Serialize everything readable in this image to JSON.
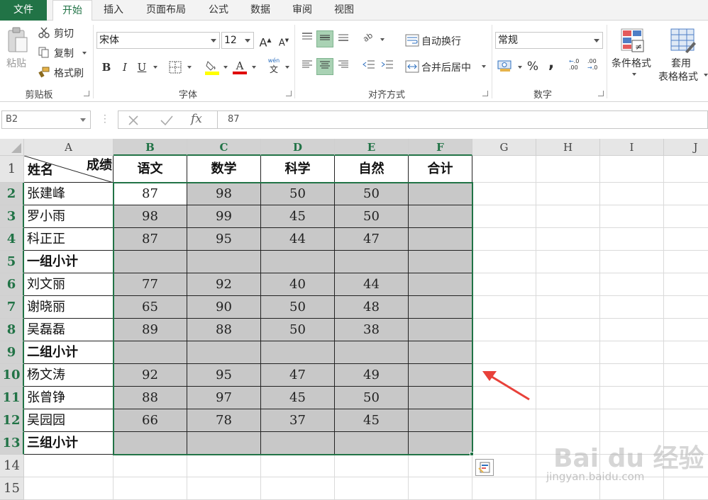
{
  "tabs": [
    "文件",
    "开始",
    "插入",
    "页面布局",
    "公式",
    "数据",
    "审阅",
    "视图"
  ],
  "active_tab": "开始",
  "ribbon": {
    "clipboard": {
      "paste": "粘贴",
      "cut": "剪切",
      "copy": "复制",
      "format_painter": "格式刷",
      "group_label": "剪贴板"
    },
    "font": {
      "font_name": "宋体",
      "font_size": "12",
      "grow": "A",
      "shrink": "A",
      "bold": "B",
      "italic": "I",
      "underline": "U",
      "font_color_glyph": "A",
      "phonetic_glyph": "wén",
      "phonetic_base": "文",
      "group_label": "字体"
    },
    "alignment": {
      "wrap_text": "自动换行",
      "merge_center": "合并后居中",
      "group_label": "对齐方式"
    },
    "number": {
      "format": "常规",
      "percent": "%",
      "comma": ",",
      "inc_decimal": ".00",
      "dec_decimal": ".0",
      "group_label": "数字"
    },
    "styles": {
      "conditional_format": "条件格式",
      "format_table_line1": "套用",
      "format_table_line2": "表格格式"
    }
  },
  "formula_bar": {
    "name_box": "B2",
    "fx": "fx",
    "value": "87"
  },
  "columns": [
    "A",
    "B",
    "C",
    "D",
    "E",
    "F",
    "G",
    "H",
    "I",
    "J"
  ],
  "rows": [
    "1",
    "2",
    "3",
    "4",
    "5",
    "6",
    "7",
    "8",
    "9",
    "10",
    "11",
    "12",
    "13",
    "14",
    "15"
  ],
  "table": {
    "corner_left": "姓名",
    "corner_right": "成绩",
    "headers": [
      "语文",
      "数学",
      "科学",
      "自然",
      "合计"
    ],
    "records": [
      {
        "name": "张建峰",
        "values": [
          "87",
          "98",
          "50",
          "50",
          ""
        ]
      },
      {
        "name": "罗小雨",
        "values": [
          "98",
          "99",
          "45",
          "50",
          ""
        ]
      },
      {
        "name": "科正正",
        "values": [
          "87",
          "95",
          "44",
          "47",
          ""
        ]
      },
      {
        "name": "一组小计",
        "values": [
          "",
          "",
          "",
          "",
          ""
        ],
        "subtotal": true
      },
      {
        "name": "刘文丽",
        "values": [
          "77",
          "92",
          "40",
          "44",
          ""
        ]
      },
      {
        "name": "谢晓丽",
        "values": [
          "65",
          "90",
          "50",
          "48",
          ""
        ]
      },
      {
        "name": "吴磊磊",
        "values": [
          "89",
          "88",
          "50",
          "38",
          ""
        ]
      },
      {
        "name": "二组小计",
        "values": [
          "",
          "",
          "",
          "",
          ""
        ],
        "subtotal": true
      },
      {
        "name": "杨文涛",
        "values": [
          "92",
          "95",
          "47",
          "49",
          ""
        ]
      },
      {
        "name": "张曾铮",
        "values": [
          "88",
          "97",
          "45",
          "50",
          ""
        ]
      },
      {
        "name": "吴园园",
        "values": [
          "66",
          "78",
          "37",
          "45",
          ""
        ]
      },
      {
        "name": "三组小计",
        "values": [
          "",
          "",
          "",
          "",
          ""
        ],
        "subtotal": true
      }
    ]
  },
  "selection": {
    "active_cell": "B2",
    "range": "B2:F13"
  },
  "colors": {
    "accent": "#217346",
    "selection_fill": "#c8c8c8",
    "arrow": "#e8413a"
  },
  "watermark": {
    "brand": "Bai du 经验",
    "url": "jingyan.baidu.com"
  }
}
